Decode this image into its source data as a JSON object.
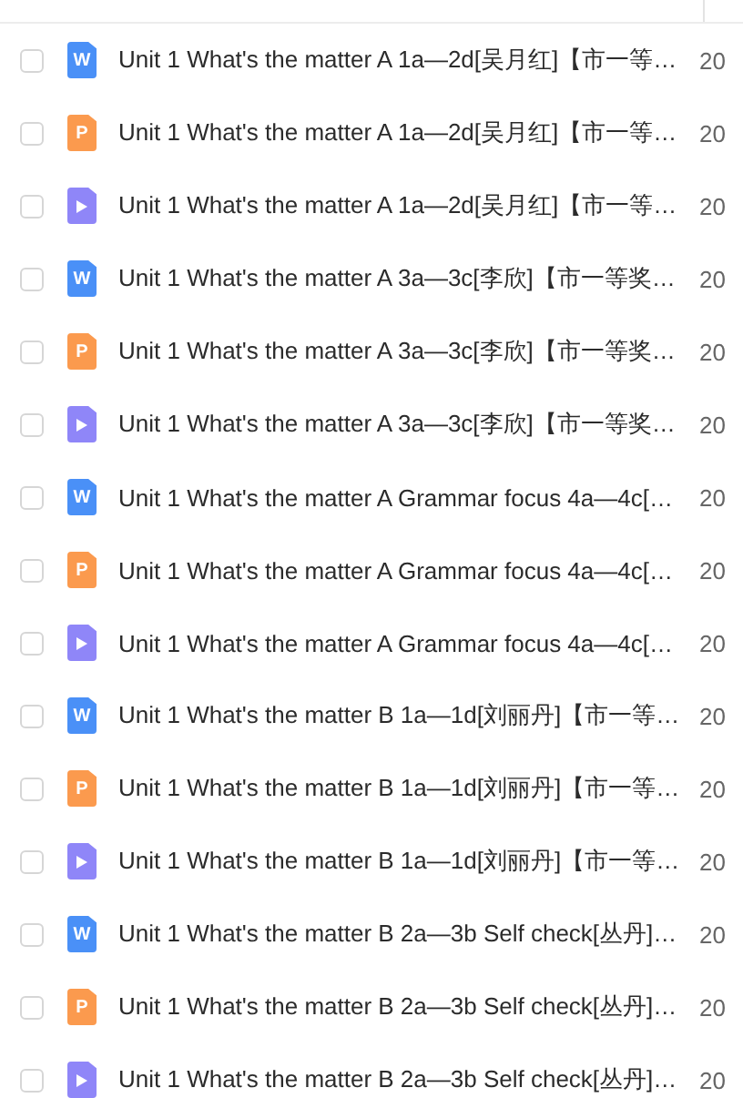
{
  "files": [
    {
      "kind": "word",
      "icon_text": "W",
      "name": "Unit 1 What's the matter A 1a—2d[吴月红]【市一等…",
      "column_2": "20",
      "checked": false
    },
    {
      "kind": "ppt",
      "icon_text": "P",
      "name": "Unit 1 What's the matter A 1a—2d[吴月红]【市一等…",
      "column_2": "20",
      "checked": false
    },
    {
      "kind": "video",
      "name": "Unit 1 What's the matter A 1a—2d[吴月红]【市一等…",
      "column_2": "20",
      "checked": false
    },
    {
      "kind": "word",
      "icon_text": "W",
      "name": "Unit 1 What's the matter A 3a—3c[李欣]【市一等奖…",
      "column_2": "20",
      "checked": false
    },
    {
      "kind": "ppt",
      "icon_text": "P",
      "name": "Unit 1 What's the matter A 3a—3c[李欣]【市一等奖…",
      "column_2": "20",
      "checked": false
    },
    {
      "kind": "video",
      "name": "Unit 1 What's the matter A 3a—3c[李欣]【市一等奖…",
      "column_2": "20",
      "checked": false
    },
    {
      "kind": "word",
      "icon_text": "W",
      "name": "Unit 1 What's the matter A Grammar focus 4a—4c[…",
      "column_2": "20",
      "checked": false
    },
    {
      "kind": "ppt",
      "icon_text": "P",
      "name": "Unit 1 What's the matter A Grammar focus 4a—4c[…",
      "column_2": "20",
      "checked": false
    },
    {
      "kind": "video",
      "name": "Unit 1 What's the matter A Grammar focus 4a—4c[…",
      "column_2": "20",
      "checked": false
    },
    {
      "kind": "word",
      "icon_text": "W",
      "name": "Unit 1 What's the matter B 1a—1d[刘丽丹]【市一等…",
      "column_2": "20",
      "checked": false
    },
    {
      "kind": "ppt",
      "icon_text": "P",
      "name": "Unit 1 What's the matter B 1a—1d[刘丽丹]【市一等…",
      "column_2": "20",
      "checked": false
    },
    {
      "kind": "video",
      "name": "Unit 1 What's the matter B 1a—1d[刘丽丹]【市一等…",
      "column_2": "20",
      "checked": false
    },
    {
      "kind": "word",
      "icon_text": "W",
      "name": "Unit 1 What's the matter B 2a—3b Self check[丛丹]…",
      "column_2": "20",
      "checked": false
    },
    {
      "kind": "ppt",
      "icon_text": "P",
      "name": "Unit 1 What's the matter B 2a—3b Self check[丛丹]…",
      "column_2": "20",
      "checked": false
    },
    {
      "kind": "video",
      "name": "Unit 1 What's the matter B 2a—3b Self check[丛丹]…",
      "column_2": "20",
      "checked": false
    }
  ]
}
